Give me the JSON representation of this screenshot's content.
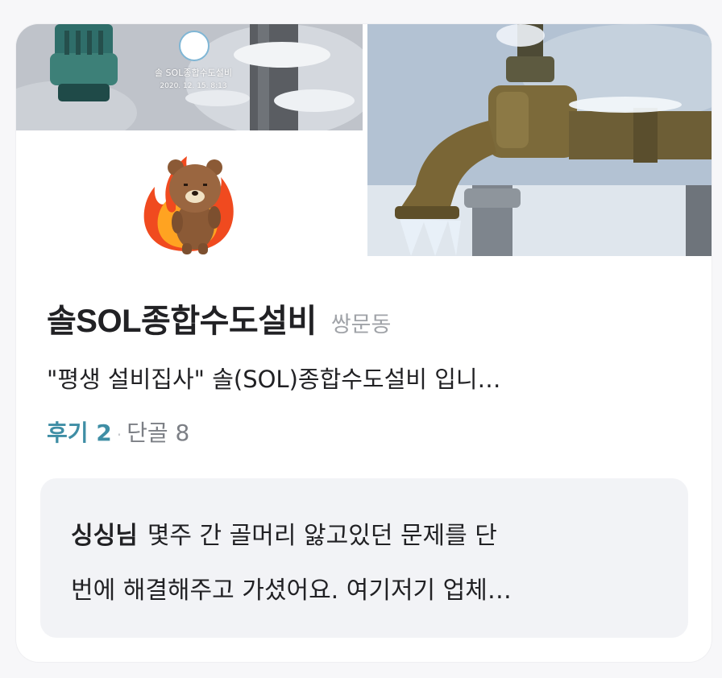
{
  "business": {
    "name": "솔SOL종합수도설비",
    "location": "쌍문동",
    "description": "\"평생 설비집사\" 솔(SOL)종합수도설비 입니…",
    "reviews_label": "후기 2",
    "separator": "·",
    "regulars_label": "단골 8"
  },
  "thumbnail": {
    "caption": "솔 SOL종합수도설비",
    "date": "2020. 12. 15. 8:13"
  },
  "review": {
    "reviewer": "싱싱님",
    "text_line1": "몇주 간 골머리 앓고있던 문제를 단",
    "text_line2": "번에 해결해주고 가셨어요. 여기저기 업체…"
  },
  "colors": {
    "accent": "#3f8ea5",
    "text": "#212124",
    "muted": "#a0a3a8",
    "review_bg": "#f2f3f6"
  }
}
